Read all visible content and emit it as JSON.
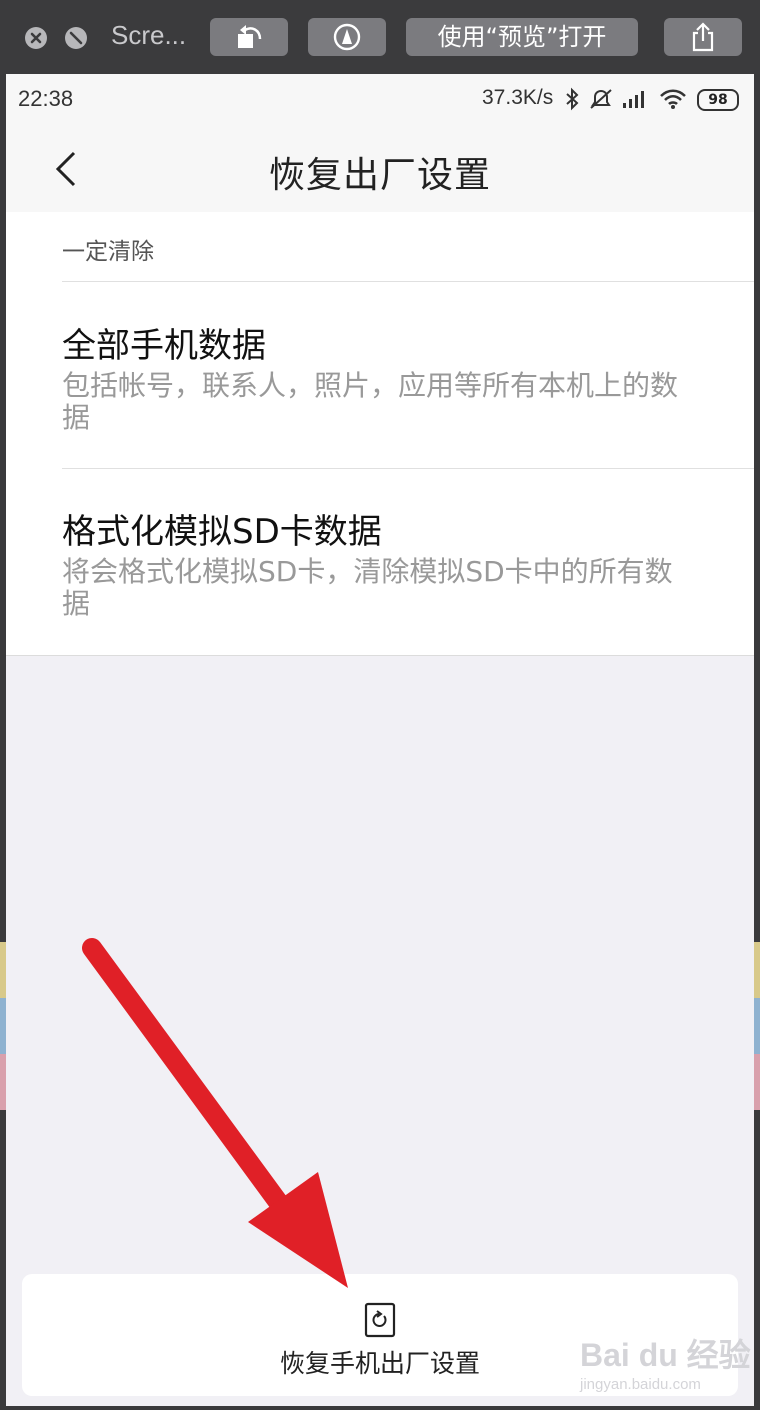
{
  "quicklook": {
    "title": "Scre...",
    "open_with_label": "使用“预览”打开",
    "icons": [
      "close-icon",
      "fullscreen-off-icon",
      "rotate-icon",
      "markup-icon",
      "share-icon"
    ]
  },
  "statusbar": {
    "time": "22:38",
    "net_speed": "37.3K/s",
    "battery": "98",
    "icons": [
      "bluetooth-icon",
      "alarm-off-icon",
      "signal-icon",
      "wifi-icon"
    ]
  },
  "header": {
    "title": "恢复出厂设置"
  },
  "card": {
    "section_label": "一定清除",
    "items": [
      {
        "title": "全部手机数据",
        "desc": "包括帐号，联系人，照片，应用等所有本机上的数据"
      },
      {
        "title": "格式化模拟SD卡数据",
        "desc": "将会格式化模拟SD卡，清除模拟SD卡中的所有数据"
      }
    ]
  },
  "bottom_button": {
    "label": "恢复手机出厂设置"
  },
  "watermark": {
    "main": "Bai  du 经验",
    "sub": "jingyan.baidu.com"
  },
  "colors": {
    "arrow": "#e02027",
    "background": "#f1f0f5"
  }
}
